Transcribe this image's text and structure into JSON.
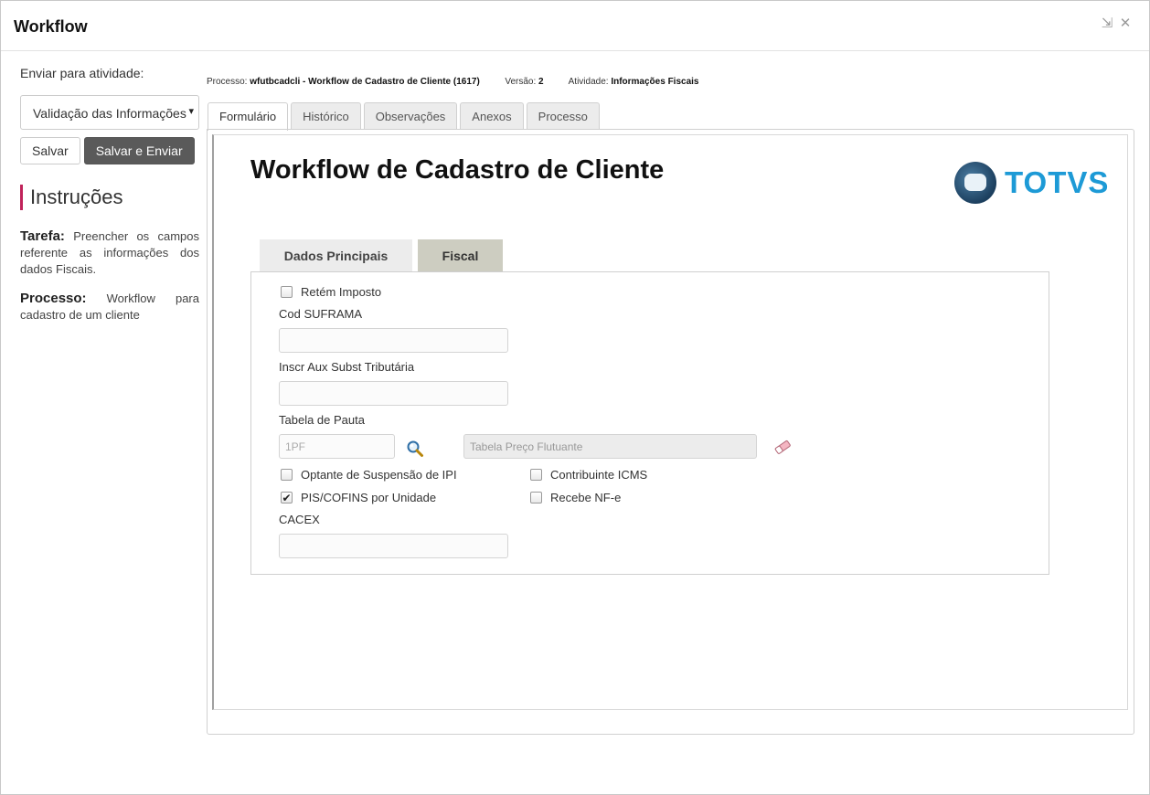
{
  "window": {
    "title": "Workflow"
  },
  "sidebar": {
    "activity_label": "Enviar para atividade:",
    "activity_select": "Validação das Informações",
    "save_label": "Salvar",
    "save_send_label": "Salvar e Enviar",
    "instructions_title": "Instruções",
    "task_label": "Tarefa:",
    "task_text": " Preencher os campos referente as informações dos dados Fiscais.",
    "process_label": "Processo:",
    "process_text": " Workflow para cadastro de um cliente"
  },
  "process_info": {
    "process_label": "Processo: ",
    "process_value": "wfutbcadcli - Workflow de Cadastro de Cliente (1617)",
    "version_label": "Versão: ",
    "version_value": "2",
    "activity_label": "Atividade: ",
    "activity_value": "Informações Fiscais"
  },
  "tabs": [
    {
      "label": "Formulário",
      "active": true
    },
    {
      "label": "Histórico"
    },
    {
      "label": "Observações"
    },
    {
      "label": "Anexos"
    },
    {
      "label": "Processo"
    }
  ],
  "form": {
    "title": "Workflow de Cadastro de Cliente",
    "logo_text": "TOTVS",
    "inner_tabs": [
      {
        "label": "Dados Principais"
      },
      {
        "label": "Fiscal",
        "active": true
      }
    ],
    "retem_imposto": {
      "label": "Retém Imposto",
      "checked": false
    },
    "cod_suframa": {
      "label": "Cod SUFRAMA",
      "value": ""
    },
    "inscr_aux": {
      "label": "Inscr Aux Subst Tributária",
      "value": ""
    },
    "tabela_pauta": {
      "label": "Tabela de Pauta",
      "code": "1PF",
      "description": "Tabela Preço Flutuante"
    },
    "optante_ipi": {
      "label": "Optante de Suspensão de IPI",
      "checked": false
    },
    "contribuinte_icms": {
      "label": "Contribuinte ICMS",
      "checked": false
    },
    "pis_cofins": {
      "label": "PIS/COFINS por Unidade",
      "checked": true,
      "mark": "✔"
    },
    "recebe_nfe": {
      "label": "Recebe NF-e",
      "checked": false
    },
    "cacex": {
      "label": "CACEX",
      "value": ""
    }
  },
  "icons": {
    "restore": "⇲",
    "close": "✕",
    "caret": "▾",
    "search": "magnifier-icon",
    "clear": "eraser-icon"
  },
  "colors": {
    "accent": "#c0235a",
    "logo_blue": "#1d9ad6",
    "active_inner_tab": "#cdcdc1"
  }
}
